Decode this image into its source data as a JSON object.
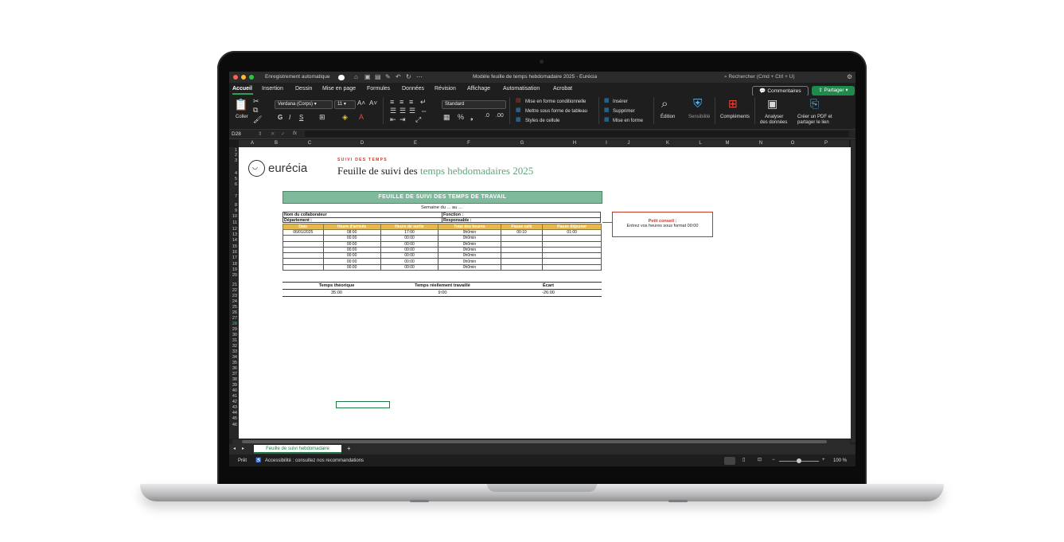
{
  "window": {
    "autosave_label": "Enregistrement automatique",
    "title": "Modèle feuille de temps hebdomadaire 2025 - Eurécia",
    "search_placeholder": "Rechercher (Cmd + Ctrl + U)"
  },
  "ribbon_tabs": [
    "Accueil",
    "Insertion",
    "Dessin",
    "Mise en page",
    "Formules",
    "Données",
    "Révision",
    "Affichage",
    "Automatisation",
    "Acrobat"
  ],
  "ribbon_buttons": {
    "comments": "Commentaires",
    "share": "Partager",
    "paste": "Coller",
    "font": "Verdana (Corps)",
    "font_size": "11",
    "number_format": "Standard",
    "conditional_format": "Mise en forme conditionnelle",
    "table_format": "Mettre sous forme de tableau",
    "cell_styles": "Styles de cellule",
    "insert": "Insérer",
    "delete": "Supprimer",
    "format": "Mise en forme",
    "editing": "Édition",
    "sensitivity": "Sensibilité",
    "addins": "Compléments",
    "analyze_1": "Analyser",
    "analyze_2": "des données",
    "pdf_1": "Créer un PDF et",
    "pdf_2": "partager le lien"
  },
  "formula_bar": {
    "cell_ref": "D28",
    "fx": "fx"
  },
  "columns": [
    "A",
    "B",
    "C",
    "D",
    "E",
    "F",
    "G",
    "H",
    "I",
    "J",
    "K",
    "L",
    "M",
    "N",
    "O",
    "P"
  ],
  "rows": [
    "1",
    "2",
    "3",
    "4",
    "5",
    "6",
    "7",
    "8",
    "9",
    "10",
    "11",
    "12",
    "13",
    "14",
    "15",
    "16",
    "17",
    "18",
    "19",
    "20",
    "21",
    "22",
    "23",
    "24",
    "25",
    "26",
    "27",
    "28",
    "29",
    "30",
    "31",
    "32",
    "33",
    "34",
    "35",
    "36",
    "37",
    "38",
    "39",
    "40",
    "41",
    "42",
    "43",
    "44",
    "45",
    "46"
  ],
  "sheet": {
    "logo_text": "eurécia",
    "kicker": "SUIVI DES TEMPS",
    "title_plain": "Feuille de suivi des ",
    "title_green": "temps hebdomadaires 2025",
    "banner": "FEUILLE DE SUIVI DES TEMPS DE TRAVAIL",
    "week": "Semaine du ... au ...",
    "employee_label": "Nom du collaborateur",
    "department_label": "Département :",
    "function_label": "Fonction :",
    "manager_label": "Responsable :",
    "table_headers": [
      "Date",
      "Heure d'arrivée",
      "Heure de sortie",
      "Total des heures",
      "Pause café",
      "Pause déjeuner"
    ],
    "table_rows": [
      [
        "06/01/2025",
        "08:00",
        "17:00",
        "9h0min",
        "00:10",
        "01:00"
      ],
      [
        "",
        "00:00",
        "00:00",
        "0h0min",
        "",
        ""
      ],
      [
        "",
        "00:00",
        "00:00",
        "0h0min",
        "",
        ""
      ],
      [
        "",
        "00:00",
        "00:00",
        "0h0min",
        "",
        ""
      ],
      [
        "",
        "00:00",
        "00:00",
        "0h0min",
        "",
        ""
      ],
      [
        "",
        "00:00",
        "00:00",
        "0h0min",
        "",
        ""
      ],
      [
        "",
        "00:00",
        "00:00",
        "0h0min",
        "",
        ""
      ]
    ],
    "summary": {
      "theoretical_label": "Temps théorique",
      "worked_label": "Temps réellement travaillé",
      "gap_label": "Écart",
      "theoretical_value": "35:00",
      "worked_value": "9:00",
      "gap_value": "-26:00"
    },
    "tip_title": "Petit conseil :",
    "tip_text": "Entrez vos heures sous format 00:00"
  },
  "sheet_tab": "Feuille de suivi hebdomadaire",
  "status": {
    "ready": "Prêt",
    "accessibility": "Accessibilité : consultez nos recommandations",
    "zoom": "100 %"
  },
  "colors": {
    "accent_green": "#1e8a4c",
    "banner_green": "#7fb99b",
    "header_gold": "#e8b84a",
    "tip_red": "#c0392b"
  }
}
